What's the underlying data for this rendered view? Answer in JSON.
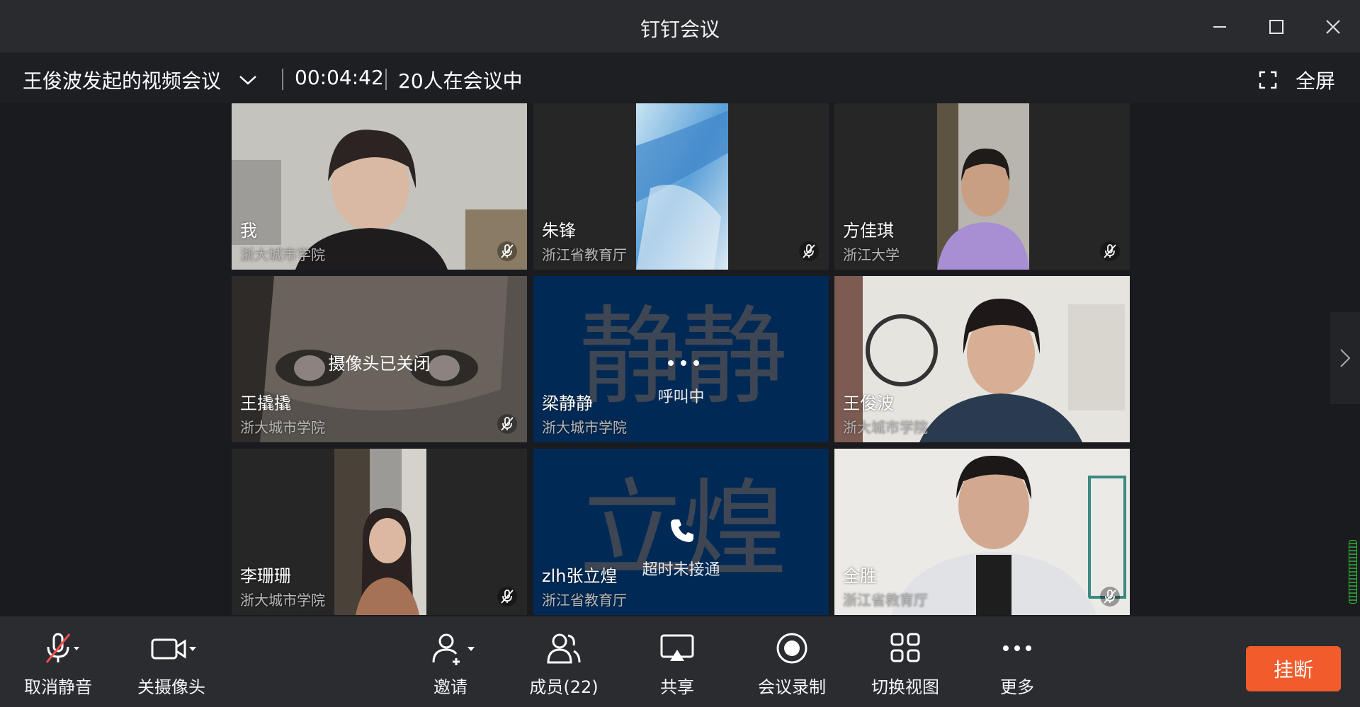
{
  "window": {
    "title": "钉钉会议"
  },
  "info": {
    "meeting_name": "王俊波发起的视频会议",
    "timer": "00:04:42",
    "participants_text": "20人在会议中",
    "fullscreen_label": "全屏"
  },
  "tiles": [
    {
      "name": "我",
      "org": "浙大城市学院"
    },
    {
      "name": "朱锋",
      "org": "浙江省教育厅"
    },
    {
      "name": "方佳琪",
      "org": "浙江大学"
    },
    {
      "name": "王撬撬",
      "org": "浙大城市学院",
      "status": "摄像头已关闭"
    },
    {
      "name": "梁静静",
      "org": "浙大城市学院",
      "avatar_text": "静静",
      "status": "呼叫中"
    },
    {
      "name": "王俊波",
      "org": "浙大城市学院"
    },
    {
      "name": "李珊珊",
      "org": "浙大城市学院"
    },
    {
      "name": "zlh张立煌",
      "org": "浙江省教育厅",
      "avatar_text": "立煌",
      "status": "超时未接通"
    },
    {
      "name": "全胜",
      "org": "浙江省教育厅"
    }
  ],
  "toolbar": {
    "unmute": "取消静音",
    "camera_off": "关摄像头",
    "invite": "邀请",
    "members": "成员(22)",
    "share": "共享",
    "record": "会议录制",
    "switch_view": "切换视图",
    "more": "更多",
    "hangup": "挂断"
  },
  "colors": {
    "hangup": "#f25b2b",
    "call_tile": "#002a55"
  }
}
